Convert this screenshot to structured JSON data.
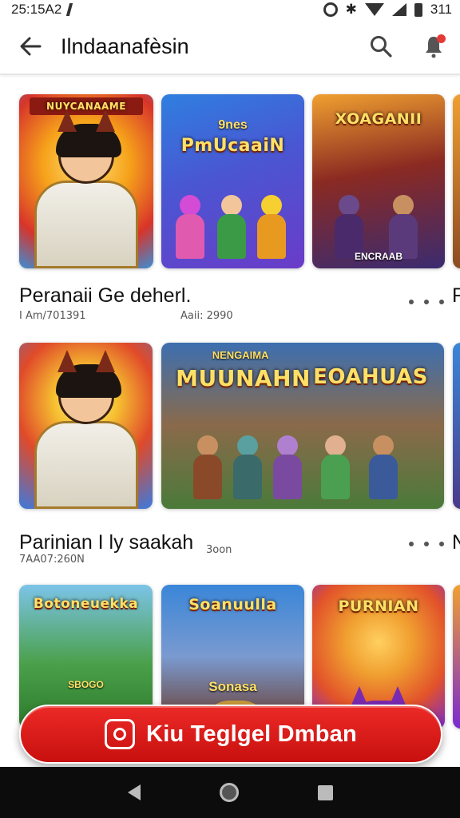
{
  "status_bar": {
    "time": "25:15A2",
    "battery_text": "311"
  },
  "app_bar": {
    "title": "Ilndaanafèsin",
    "back_icon": "arrow-back-icon",
    "search_icon": "search-icon",
    "notification_icon": "notification-bell-icon"
  },
  "rows": [
    {
      "title": "Peranaii Ge deherl.",
      "meta_left": "I Am/701391",
      "meta_right": "Aaii: 2990",
      "edge_letter": "F",
      "cards": [
        {
          "banner": "NUYCANAAME",
          "sub": "",
          "palette": [
            "#f6a21a",
            "#d8342a",
            "#3a8fd6"
          ]
        },
        {
          "banner": "PmUcaaiN",
          "sub": "9nes",
          "palette": [
            "#2f7fe0",
            "#6a3cc8",
            "#f2c53a"
          ]
        },
        {
          "banner": "XOAGANII",
          "sub": "ENCRAAB",
          "palette": [
            "#8b2a22",
            "#3b2b70",
            "#f0a030"
          ]
        }
      ]
    },
    {
      "title": "Parinian I ly saakah",
      "meta_left": "7AA07:260N",
      "meta_right": "3oon",
      "edge_letter": "N",
      "cards": [
        {
          "banner": "",
          "sub": "",
          "palette": [
            "#3a7ae0",
            "#e04a2a",
            "#f6c030"
          ]
        },
        {
          "banner": "MUUNAHN",
          "sub": "NENGAIMA",
          "banner2": "EOAHUAS",
          "palette": [
            "#3d6fb0",
            "#6a3f2a",
            "#f2b030"
          ]
        }
      ]
    },
    {
      "cards": [
        {
          "banner": "Botoneuekka",
          "sub": "SBOGO",
          "palette": [
            "#2e9a3c",
            "#7cc4e8",
            "#f0c030"
          ]
        },
        {
          "banner": "Soanuulla",
          "sub": "Sonasa",
          "palette": [
            "#3a86d8",
            "#f0a830",
            "#6a3a2a"
          ]
        },
        {
          "banner": "PURNIAN",
          "sub": "",
          "palette": [
            "#e2522a",
            "#7a2ad0",
            "#f6c030"
          ]
        }
      ]
    }
  ],
  "cta": {
    "label": "Kiu Teglgel Dmban",
    "icon": "instagram-camera-icon",
    "color": "#e21f1d"
  },
  "nav_bar": {
    "back_icon": "nav-back-icon",
    "home_icon": "nav-home-icon",
    "recents_icon": "nav-recents-icon"
  }
}
